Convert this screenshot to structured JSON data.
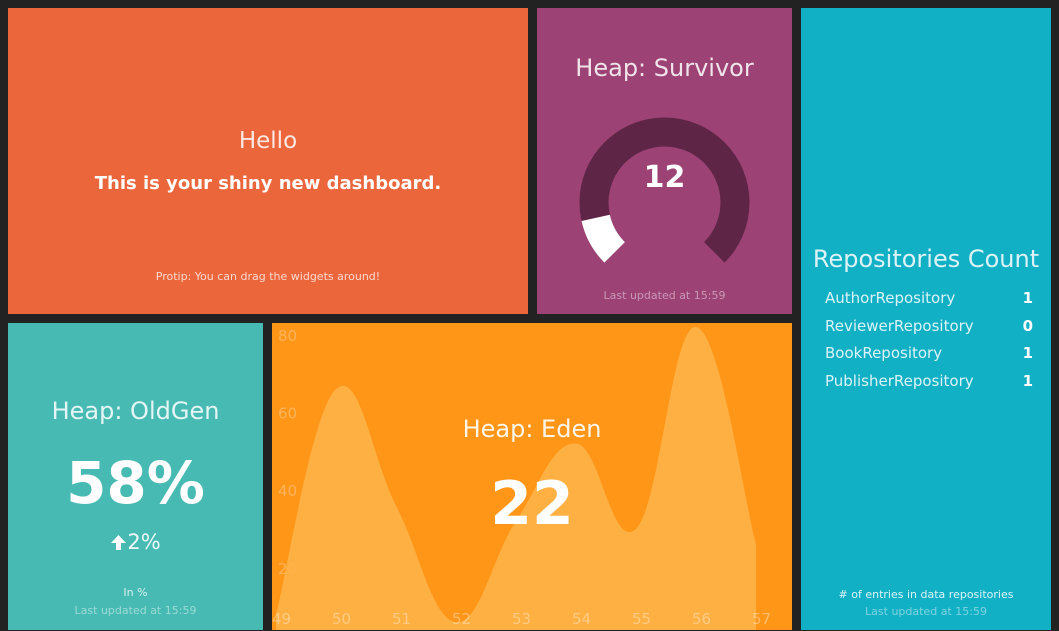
{
  "hello": {
    "title": "Hello",
    "text": "This is your shiny new dashboard.",
    "moreinfo": "Protip: You can drag the widgets around!"
  },
  "survivor": {
    "title": "Heap: Survivor",
    "value": "12",
    "gauge_fraction": 0.12,
    "updated": "Last updated at 15:59"
  },
  "oldgen": {
    "title": "Heap: OldGen",
    "value": "58%",
    "diff": "2%",
    "diff_icon": "arrow-up-icon",
    "moreinfo": "In %",
    "updated": "Last updated at 15:59"
  },
  "eden": {
    "title": "Heap: Eden",
    "value": "22"
  },
  "repositories": {
    "title": "Repositories Count",
    "items": [
      {
        "label": "AuthorRepository",
        "value": "1"
      },
      {
        "label": "ReviewerRepository",
        "value": "0"
      },
      {
        "label": "BookRepository",
        "value": "1"
      },
      {
        "label": "PublisherRepository",
        "value": "1"
      }
    ],
    "moreinfo": "# of entries in data repositories",
    "updated": "Last updated at 15:59"
  },
  "colors": {
    "hello": "#ec663c",
    "survivor": "#9c4274",
    "oldgen": "#47bbb3",
    "eden": "#ff9618",
    "repositories": "#12b0c5"
  },
  "chart_data": {
    "type": "area",
    "x": [
      49,
      50,
      51,
      52,
      53,
      54,
      55,
      56,
      57
    ],
    "x_ticks": [
      "49",
      "50",
      "51",
      "52",
      "53",
      "54",
      "55",
      "56",
      "57"
    ],
    "y_ticks": [
      "20",
      "40",
      "60",
      "80"
    ],
    "series": [
      {
        "values": [
          8,
          66,
          36,
          6,
          32,
          52,
          30,
          82,
          26
        ]
      }
    ],
    "xlim": [
      49,
      57.5
    ],
    "ylim": [
      5,
      82
    ],
    "grid": false
  }
}
